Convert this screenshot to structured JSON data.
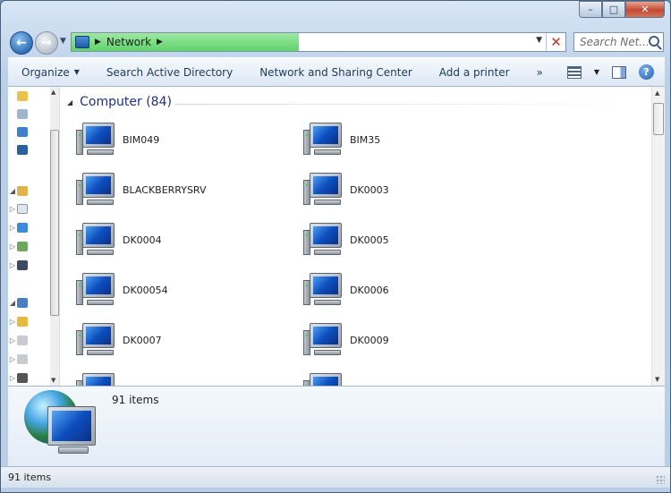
{
  "window": {
    "controls": {
      "minimize": "–",
      "maximize": "□",
      "close": "✕"
    }
  },
  "address_bar": {
    "location": "Network",
    "separator": "▶",
    "dropdown_glyph": "▼",
    "stop_glyph": "✕",
    "load_progress": 0.46
  },
  "search": {
    "placeholder": "Search Net..."
  },
  "toolbar": {
    "organize": "Organize",
    "search_ad": "Search Active Directory",
    "network_sharing": "Network and Sharing Center",
    "add_printer": "Add a printer",
    "more": "»"
  },
  "group": {
    "title": "Computer (84)"
  },
  "computers": [
    "BIM049",
    "BIM35",
    "BLACKBERRYSRV",
    "DK0003",
    "DK0004",
    "DK0005",
    "DK00054",
    "DK0006",
    "DK0007",
    "DK0009"
  ],
  "details": {
    "count": "91 items"
  },
  "status": {
    "text": "91 items"
  },
  "icons": {
    "back": "back-arrow-icon",
    "forward": "forward-arrow-icon",
    "network": "network-icon",
    "computer": "computer-icon"
  }
}
